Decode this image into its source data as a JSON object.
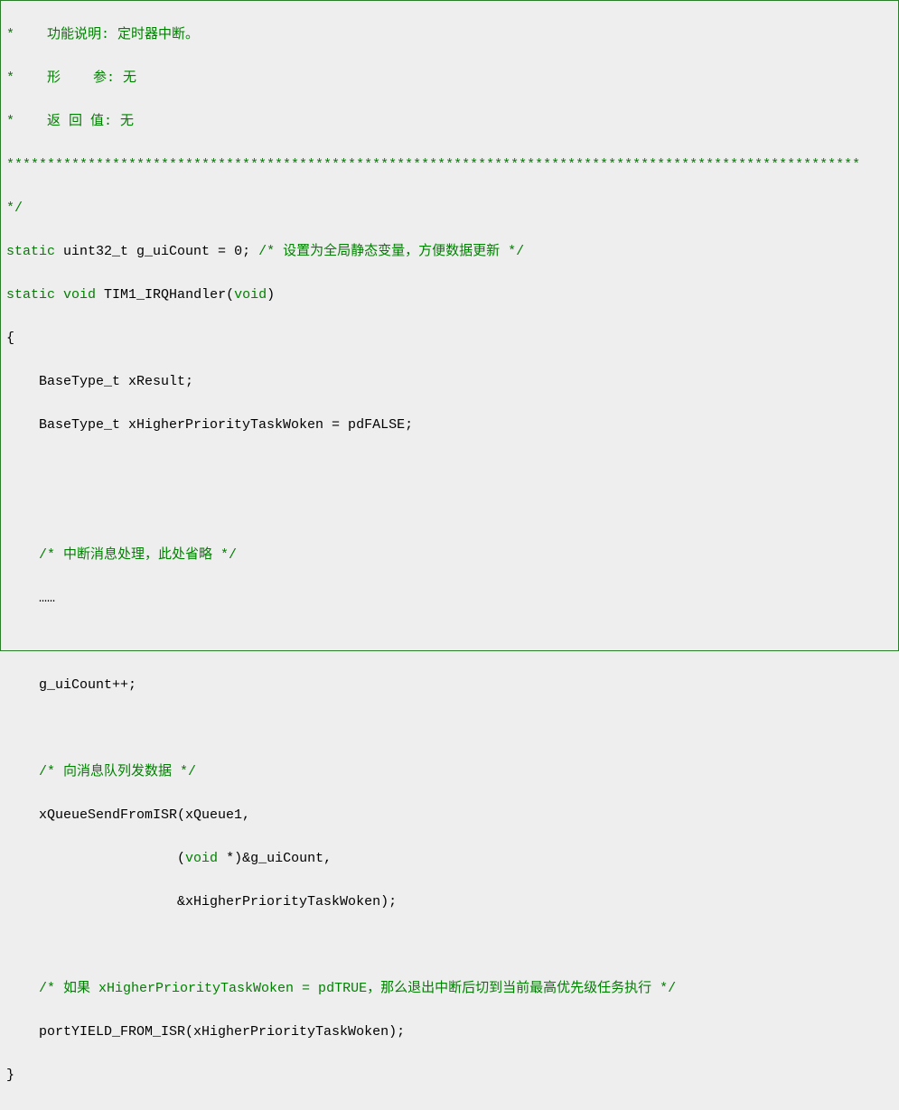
{
  "code": {
    "l1": "*    功能说明: 定时器中断。",
    "l2": "*    形    参: 无",
    "l3": "*    返 回 值: 无",
    "l4": "*********************************************************************************************************",
    "l5": "*/",
    "l6a": "static",
    "l6b": " uint32_t g_uiCount = ",
    "l6c": "0",
    "l6d": "; ",
    "l6e": "/* 设置为全局静态变量，方便数据更新 */",
    "l7a": "static",
    "l7b": " ",
    "l7c": "void",
    "l7d": " TIM1_IRQHandler(",
    "l7e": "void",
    "l7f": ")",
    "l8": "{",
    "l9": "    BaseType_t xResult;",
    "l10": "    BaseType_t xHigherPriorityTaskWoken = pdFALSE;",
    "l11": "",
    "l12": "",
    "l13a": "    ",
    "l13b": "/* 中断消息处理，此处省略 */",
    "l14": "    ……",
    "l15": "",
    "l16": "    g_uiCount++;",
    "l17": "",
    "l18a": "    ",
    "l18b": "/* 向消息队列发数据 */",
    "l19": "    xQueueSendFromISR(xQueue1,",
    "l20a": "                     (",
    "l20b": "void",
    "l20c": " *)&g_uiCount,",
    "l21": "                     &xHigherPriorityTaskWoken);",
    "l22": "",
    "l23a": "    ",
    "l23b": "/* 如果 xHigherPriorityTaskWoken = pdTRUE，那么退出中断后切到当前最高优先级任务执行 */",
    "l24": "    portYIELD_FROM_ISR(xHigherPriorityTaskWoken);",
    "l25": "}"
  }
}
